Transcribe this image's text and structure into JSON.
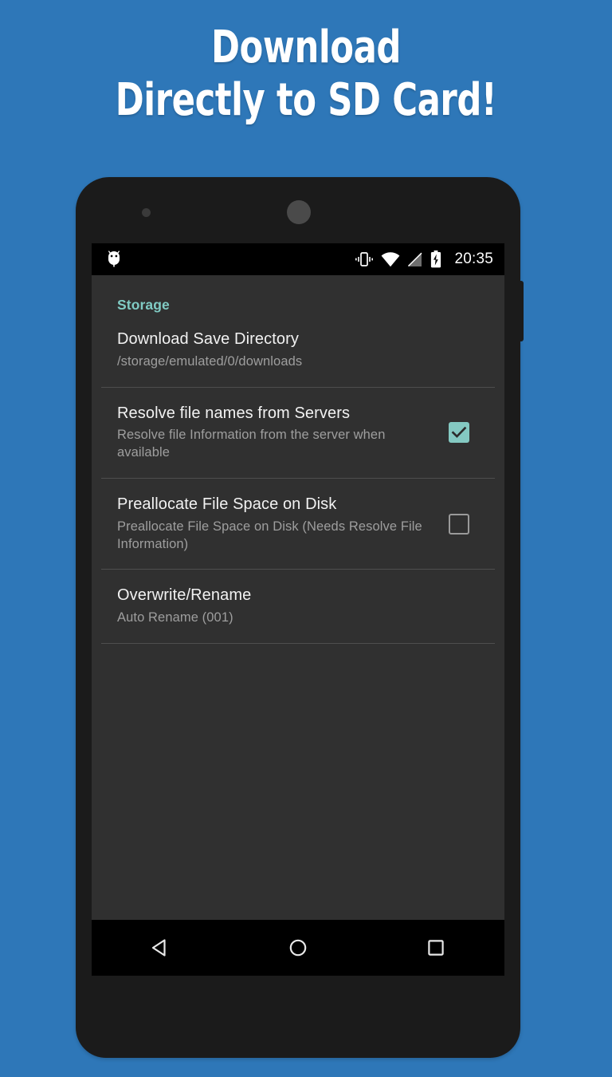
{
  "promo": {
    "headline_line1": "Download",
    "headline_line2": "Directly to SD Card!",
    "background_color": "#2E77B8",
    "headline_color": "#FFFFFF"
  },
  "device": {
    "body_color": "#1B1B1B",
    "screen_background": "#303030",
    "power_button": "power-button",
    "sensor": "proximity-sensor",
    "earpiece": "earpiece-speaker"
  },
  "statusbar": {
    "background_color": "#000000",
    "app_icon": "android-droid-icon",
    "icons": [
      {
        "name": "vibrate-icon",
        "label": "Vibrate"
      },
      {
        "name": "wifi-icon",
        "label": "Wi-Fi"
      },
      {
        "name": "no-sim-signal-icon",
        "label": "No SIM"
      },
      {
        "name": "battery-charging-icon",
        "label": "Charging"
      }
    ],
    "time": "20:35"
  },
  "settings": {
    "section_title": "Storage",
    "accent_color": "#80CBC4",
    "checkbox_checked_color": "#84C9C2",
    "checkbox_unchecked_color": "#9A9A9A",
    "items": [
      {
        "name": "download-save-directory",
        "title": "Download Save Directory",
        "summary": "/storage/emulated/0/downloads",
        "control": "none",
        "checked": false
      },
      {
        "name": "resolve-file-names",
        "title": "Resolve file names from Servers",
        "summary": "Resolve file Information from the server when available",
        "control": "checkbox",
        "checked": true
      },
      {
        "name": "preallocate-file-space",
        "title": "Preallocate File Space on Disk",
        "summary": "Preallocate File Space on Disk (Needs Resolve File Information)",
        "control": "checkbox",
        "checked": false
      },
      {
        "name": "overwrite-rename",
        "title": "Overwrite/Rename",
        "summary": "Auto Rename (001)",
        "control": "none",
        "checked": false
      }
    ]
  },
  "navbar": {
    "background_color": "#000000",
    "buttons": [
      {
        "name": "back-button",
        "icon": "back-triangle-icon",
        "label": "Back"
      },
      {
        "name": "home-button",
        "icon": "home-circle-icon",
        "label": "Home"
      },
      {
        "name": "recents-button",
        "icon": "recents-square-icon",
        "label": "Recents"
      }
    ]
  }
}
